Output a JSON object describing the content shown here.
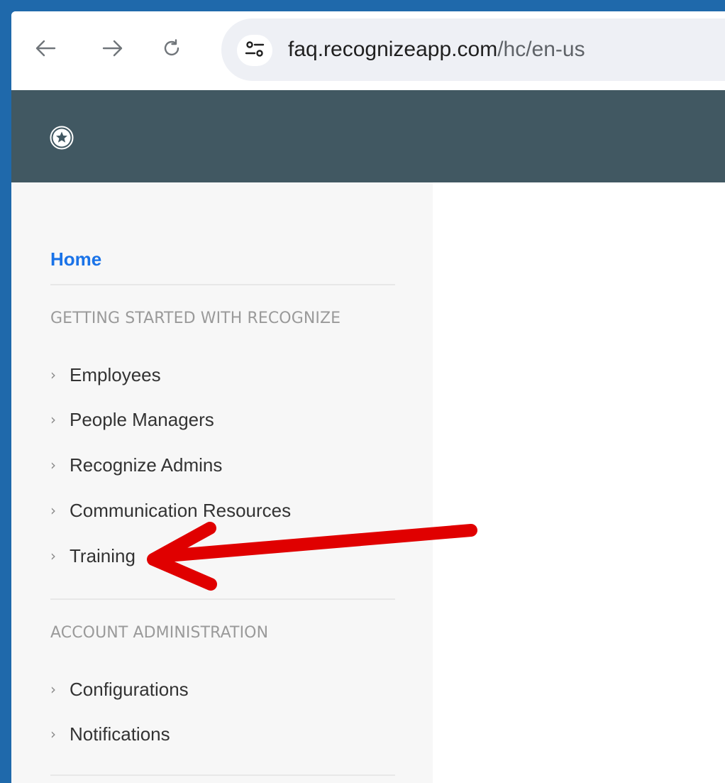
{
  "browser": {
    "url_host": "faq.recognizeapp.com",
    "url_path": "/hc/en-us",
    "icons": {
      "back": "arrow-left-icon",
      "forward": "arrow-right-icon",
      "reload": "reload-icon",
      "site_info": "tune-icon"
    }
  },
  "header": {
    "logo_icon": "star-badge-icon",
    "background": "#415862"
  },
  "sidebar": {
    "home_label": "Home",
    "home_color": "#1a73e8",
    "sections": [
      {
        "heading": "GETTING STARTED WITH RECOGNIZE",
        "items": [
          {
            "label": "Employees"
          },
          {
            "label": "People Managers"
          },
          {
            "label": "Recognize Admins"
          },
          {
            "label": "Communication Resources"
          },
          {
            "label": "Training"
          }
        ]
      },
      {
        "heading": "ACCOUNT ADMINISTRATION",
        "items": [
          {
            "label": "Configurations"
          },
          {
            "label": "Notifications"
          }
        ]
      }
    ]
  },
  "annotation": {
    "type": "arrow",
    "color": "#e00000",
    "points_to": "Training"
  },
  "colors": {
    "outer_border": "#1f69ab",
    "sidebar_bg": "#f7f7f7"
  }
}
